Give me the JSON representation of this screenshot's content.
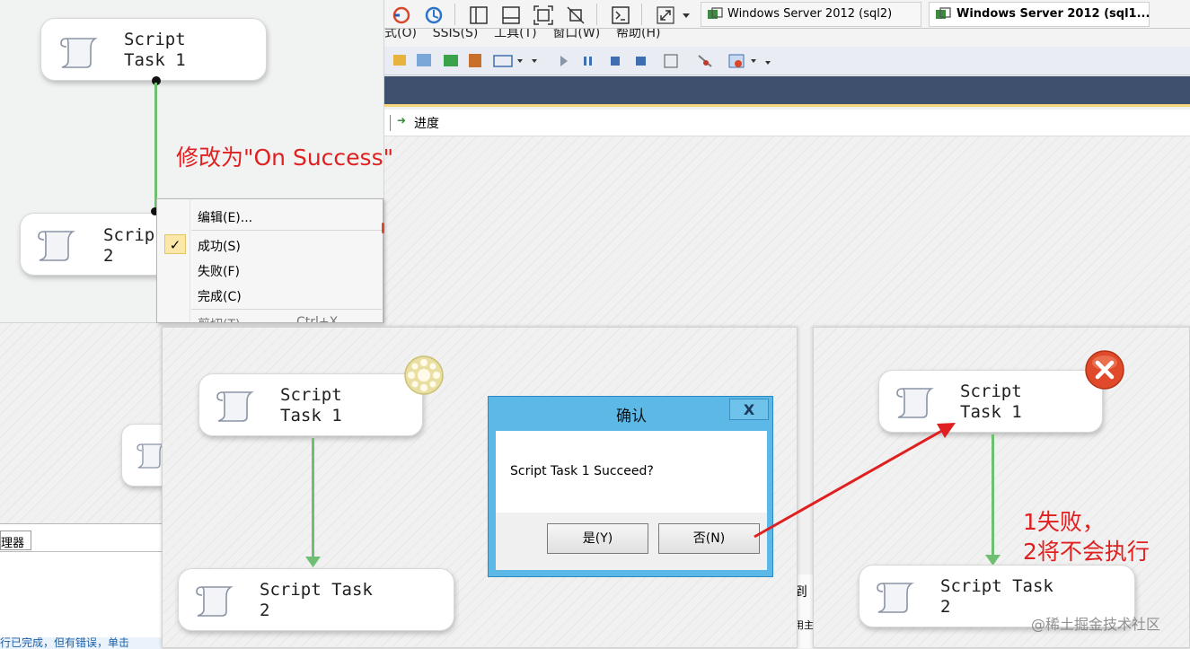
{
  "top_tabs": [
    {
      "label": "Windows Server 2012 (sql2)"
    },
    {
      "label": "Windows Server 2012 (sql1..."
    }
  ],
  "menu_partial": "式(O)    SSIS(S)    工具(T)    窗口(W)    帮助(H)",
  "progress_tab": "进度",
  "top_panel": {
    "task1": "Script\nTask 1",
    "task2_partial": "Scrip\n2",
    "annotation": "修改为\"On Success\""
  },
  "context_menu": {
    "items": [
      "编辑(E)...",
      "成功(S)",
      "失败(F)",
      "完成(C)"
    ],
    "cut_partial": "剪切(T)",
    "shortcut_partial": "Ctrl+X",
    "checked_index": 1
  },
  "middle_panel": {
    "task1": "Script\nTask 1",
    "task2": "Script Task\n2"
  },
  "dialog": {
    "title": "确认",
    "message": "Script Task 1 Succeed?",
    "yes_label": "是(Y)",
    "no_label": "否(N)",
    "close_glyph": "X"
  },
  "right_panel": {
    "task1": "Script\nTask 1",
    "task2": "Script Task\n2",
    "annotation_line1": "1失败，",
    "annotation_line2": "2将不会执行"
  },
  "background": {
    "bottom_tab": "理器",
    "status_partial": "行已完成，但有错误，单击",
    "side_text1": "]到",
    "side_text2": "用主"
  },
  "watermark": "@稀土掘金技术社区",
  "colors": {
    "connector": "#6fbf73",
    "annotation": "#e02020",
    "dialog_border": "#3ba0d8",
    "error_icon": "#e04a2a",
    "ribbon": "#3f4f6e"
  }
}
